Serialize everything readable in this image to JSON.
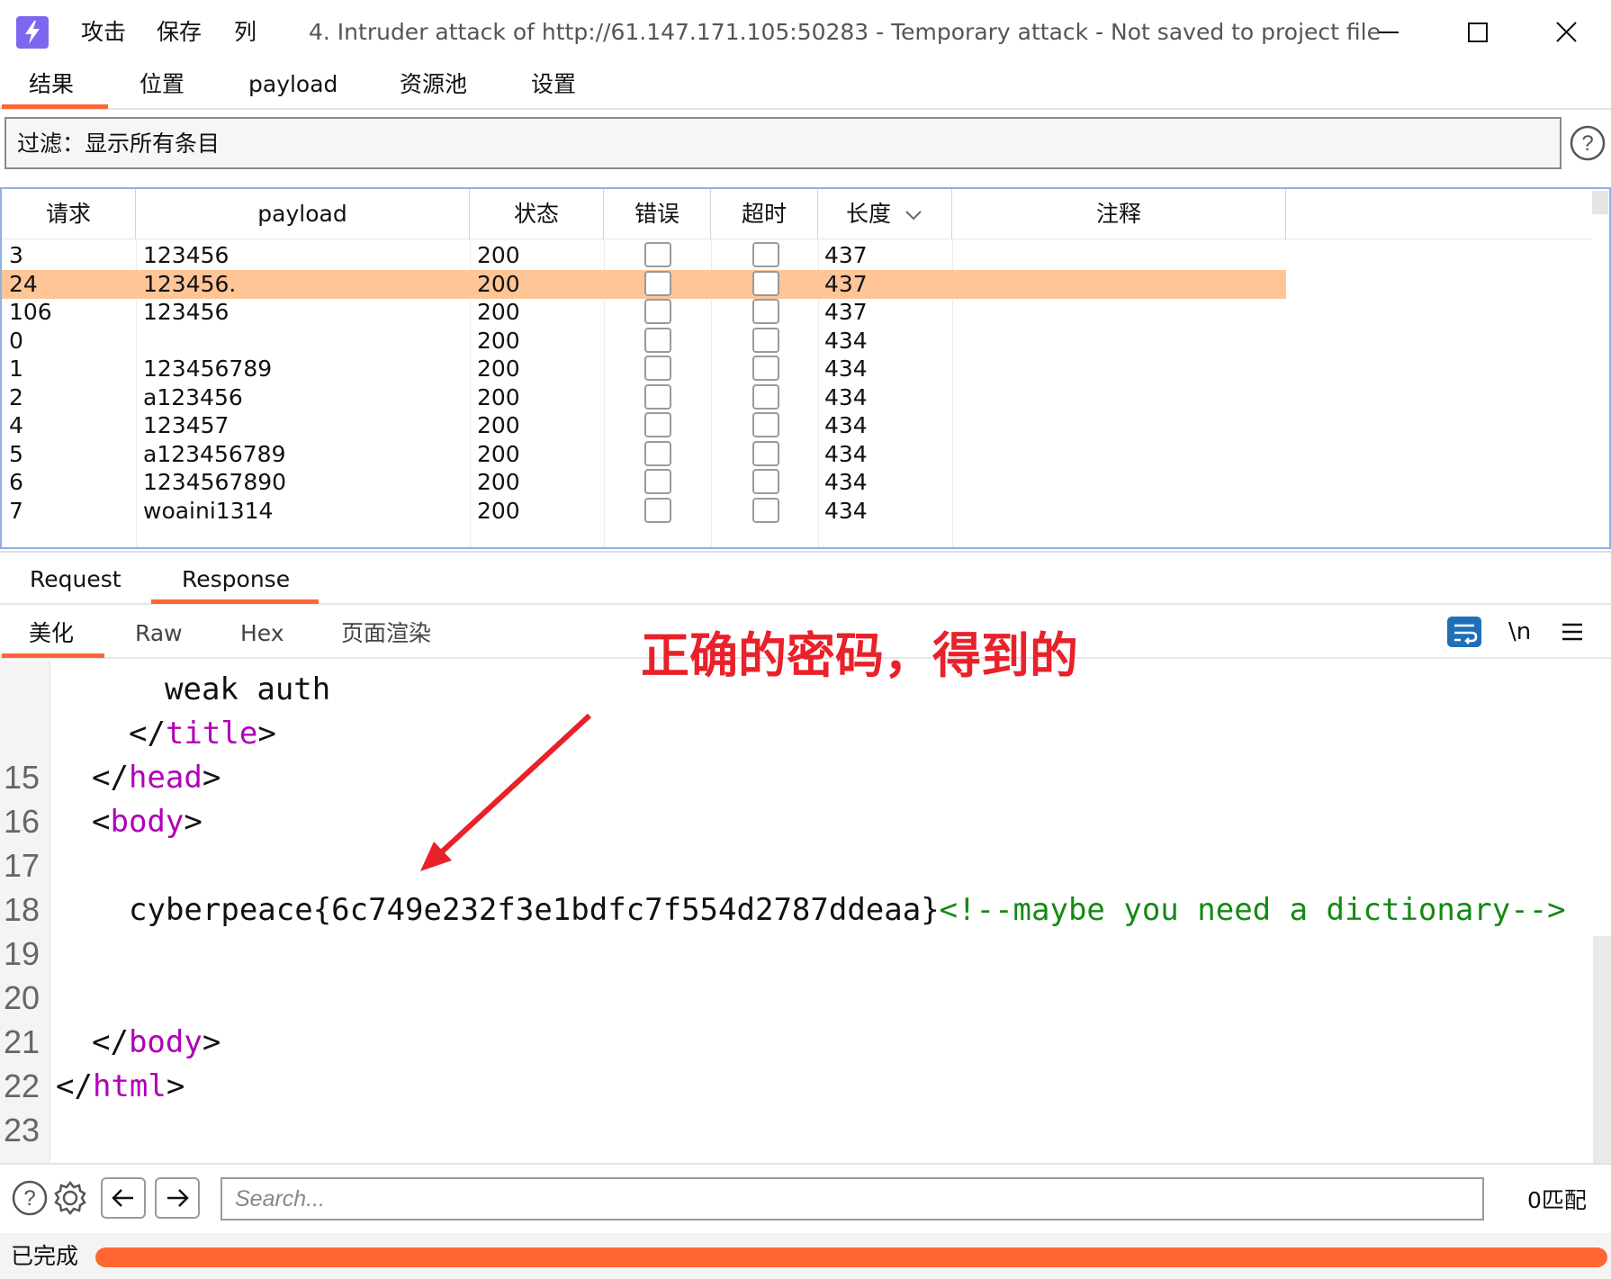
{
  "titlebar": {
    "menu": [
      "攻击",
      "保存",
      "列"
    ],
    "title": "4. Intruder attack of http://61.147.171.105:50283 - Temporary attack - Not saved to project file",
    "icons": [
      "app-logo-icon",
      "minimize-icon",
      "maximize-icon",
      "close-icon"
    ]
  },
  "main_tabs": [
    "结果",
    "位置",
    "payload",
    "资源池",
    "设置"
  ],
  "active_main_tab": "结果",
  "filter": {
    "label": "过滤：显示所有条目"
  },
  "table": {
    "columns": [
      "请求",
      "payload",
      "状态",
      "错误",
      "超时",
      "长度",
      "注释"
    ],
    "sort_column": "长度",
    "sort_direction": "descending",
    "rows": [
      {
        "request": "3",
        "payload": "123456",
        "status": "200",
        "error": false,
        "timeout": false,
        "length": "437",
        "comment": "",
        "selected": false
      },
      {
        "request": "24",
        "payload": "123456.",
        "status": "200",
        "error": false,
        "timeout": false,
        "length": "437",
        "comment": "",
        "selected": true
      },
      {
        "request": "106",
        "payload": "123456",
        "status": "200",
        "error": false,
        "timeout": false,
        "length": "437",
        "comment": "",
        "selected": false
      },
      {
        "request": "0",
        "payload": "",
        "status": "200",
        "error": false,
        "timeout": false,
        "length": "434",
        "comment": "",
        "selected": false
      },
      {
        "request": "1",
        "payload": "123456789",
        "status": "200",
        "error": false,
        "timeout": false,
        "length": "434",
        "comment": "",
        "selected": false
      },
      {
        "request": "2",
        "payload": "a123456",
        "status": "200",
        "error": false,
        "timeout": false,
        "length": "434",
        "comment": "",
        "selected": false
      },
      {
        "request": "4",
        "payload": "123457",
        "status": "200",
        "error": false,
        "timeout": false,
        "length": "434",
        "comment": "",
        "selected": false
      },
      {
        "request": "5",
        "payload": "a123456789",
        "status": "200",
        "error": false,
        "timeout": false,
        "length": "434",
        "comment": "",
        "selected": false
      },
      {
        "request": "6",
        "payload": "1234567890",
        "status": "200",
        "error": false,
        "timeout": false,
        "length": "434",
        "comment": "",
        "selected": false
      },
      {
        "request": "7",
        "payload": "woaini1314",
        "status": "200",
        "error": false,
        "timeout": false,
        "length": "434",
        "comment": "",
        "selected": false
      }
    ],
    "selected_row_color": "#ffc597"
  },
  "rr_tabs": [
    "Request",
    "Response"
  ],
  "active_rr_tab": "Response",
  "view_tabs": [
    "美化",
    "Raw",
    "Hex",
    "页面渲染"
  ],
  "active_view_tab": "美化",
  "view_toolbar": {
    "newline_label": "\\n",
    "icons": [
      "word-wrap-icon",
      "hamburger-menu-icon"
    ]
  },
  "editor": {
    "line_numbers": [
      "15",
      "16",
      "17",
      "18",
      "19",
      "20",
      "21",
      "22",
      "23"
    ],
    "lines": {
      "title_text": "weak auth",
      "close_title_open": "</",
      "close_title_tag": "title",
      "close_title_end": ">",
      "l15_open": "</",
      "l15_tag": "head",
      "l15_end": ">",
      "l16_open": "<",
      "l16_tag": "body",
      "l16_end": ">",
      "l18_text": "cyberpeace{6c749e232f3e1bdfc7f554d2787ddeaa}",
      "l18_comment": "<!--maybe you need a dictionary-->",
      "l21_open": "</",
      "l21_tag": "body",
      "l21_end": ">",
      "l22_open": "</",
      "l22_tag": "html",
      "l22_end": ">"
    },
    "tag_color": "#b000b8",
    "comment_color": "#138a13"
  },
  "annotation": {
    "text": "正确的密码，得到的",
    "color": "#e8212a"
  },
  "search": {
    "placeholder": "Search...",
    "match_count": "0匹配",
    "icons": [
      "help-icon",
      "gear-icon",
      "arrow-left-icon",
      "arrow-right-icon"
    ]
  },
  "status": {
    "text": "已完成",
    "progress": 1.0,
    "progress_color": "#ff6633"
  },
  "colors": {
    "accent": "#ff6633",
    "app_icon": "#7b68ee"
  }
}
